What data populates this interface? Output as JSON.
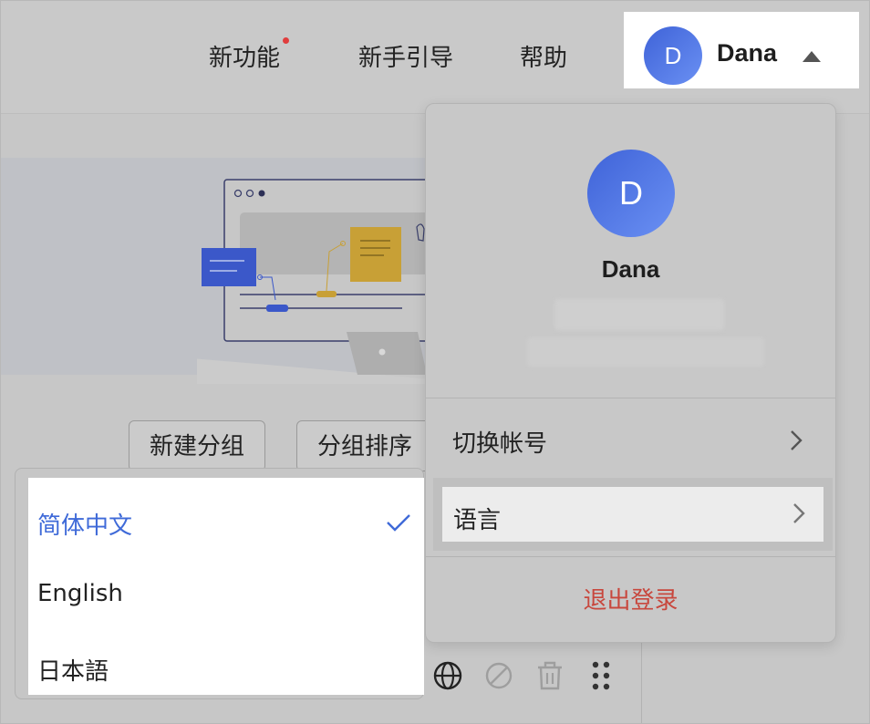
{
  "topnav": {
    "items": [
      {
        "label": "新功能",
        "has_dot": true
      },
      {
        "label": "新手引导"
      },
      {
        "label": "帮助"
      }
    ]
  },
  "user": {
    "initial": "D",
    "name": "Dana"
  },
  "group_buttons": {
    "new_group": "新建分组",
    "sort_group": "分组排序"
  },
  "user_panel": {
    "initial": "D",
    "name": "Dana",
    "menu": [
      {
        "label": "切换帐号"
      },
      {
        "label": "语言"
      }
    ],
    "logout": "退出登录"
  },
  "language_menu": {
    "options": [
      {
        "label": "简体中文",
        "selected": true
      },
      {
        "label": "English",
        "selected": false
      },
      {
        "label": "日本語",
        "selected": false
      }
    ]
  },
  "toolbar_icons": [
    "globe-icon",
    "disabled-icon",
    "trash-icon",
    "drag-handle-icon"
  ],
  "colors": {
    "accent": "#3f6ad8",
    "danger": "#c8473d",
    "notify_dot": "#e03d3d"
  }
}
